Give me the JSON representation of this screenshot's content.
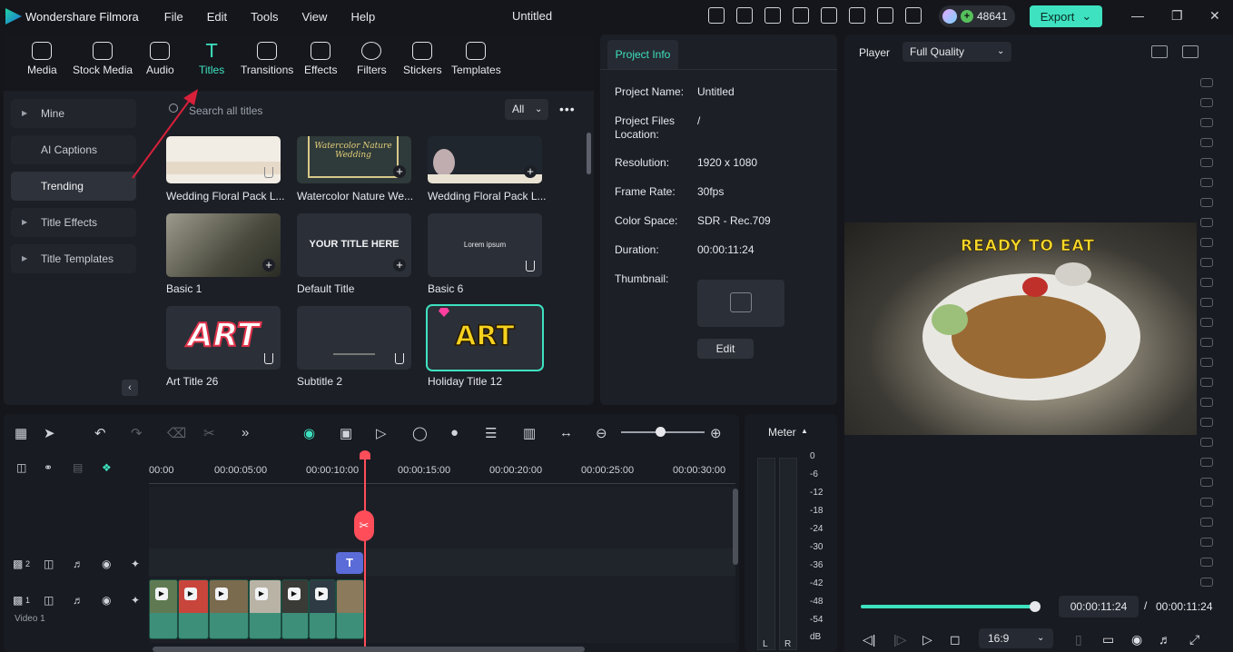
{
  "app": {
    "name": "Wondershare Filmora",
    "menu": [
      "File",
      "Edit",
      "Tools",
      "View",
      "Help"
    ],
    "document_title": "Untitled",
    "credits": "48641",
    "export_label": "Export"
  },
  "library": {
    "tabs": [
      "Media",
      "Stock Media",
      "Audio",
      "Titles",
      "Transitions",
      "Effects",
      "Filters",
      "Stickers",
      "Templates"
    ],
    "active_tab": "Titles",
    "sidebar": [
      "Mine",
      "AI Captions",
      "Trending",
      "Title Effects",
      "Title Templates"
    ],
    "active_sidebar": "Trending",
    "search_placeholder": "Search all titles",
    "filter_value": "All",
    "cards": [
      {
        "label": "Wedding Floral Pack L...",
        "badge": ""
      },
      {
        "label": "Watercolor Nature We...",
        "badge": "",
        "art_text": "Watercolor Nature Wedding"
      },
      {
        "label": "Wedding Floral Pack L...",
        "badge": ""
      },
      {
        "label": "Basic 1",
        "badge": ""
      },
      {
        "label": "Default Title",
        "badge": "",
        "art_text": "YOUR TITLE HERE"
      },
      {
        "label": "Basic 6",
        "badge": "",
        "art_text": "Lorem ipsum"
      },
      {
        "label": "Art Title 26",
        "badge": "",
        "art_text": "ART"
      },
      {
        "label": "Subtitle 2",
        "badge": ""
      },
      {
        "label": "Holiday Title 12",
        "badge": "premium",
        "art_text": "ART"
      }
    ]
  },
  "project_info": {
    "tab": "Project Info",
    "rows": [
      {
        "label": "Project Name:",
        "value": "Untitled"
      },
      {
        "label": "Project Files Location:",
        "value": "/"
      },
      {
        "label": "Resolution:",
        "value": "1920 x 1080"
      },
      {
        "label": "Frame Rate:",
        "value": "30fps"
      },
      {
        "label": "Color Space:",
        "value": "SDR - Rec.709"
      },
      {
        "label": "Duration:",
        "value": "00:00:11:24"
      }
    ],
    "thumbnail_label": "Thumbnail:",
    "edit_label": "Edit"
  },
  "player": {
    "label": "Player",
    "quality": "Full Quality",
    "caption": "READY TO EAT",
    "current_time": "00:00:11:24",
    "separator": "/",
    "total_time": "00:00:11:24",
    "aspect_ratio": "16:9",
    "progress": 1.0
  },
  "timeline": {
    "ruler": [
      "00:00",
      "00:00:05:00",
      "00:00:10:00",
      "00:00:15:00",
      "00:00:20:00",
      "00:00:25:00",
      "00:00:30:00"
    ],
    "track2_number": "2",
    "track1_number": "1",
    "track1_label": "Video 1",
    "title_chip": "T"
  },
  "meter": {
    "title": "Meter",
    "scale": [
      "0",
      "-6",
      "-12",
      "-18",
      "-24",
      "-30",
      "-36",
      "-42",
      "-48",
      "-54",
      "dB"
    ],
    "left": "L",
    "right": "R"
  },
  "colors": {
    "accent": "#3ee2c0",
    "playhead": "#ff4d5a",
    "panel": "#1c1f26",
    "background": "#14161b"
  }
}
